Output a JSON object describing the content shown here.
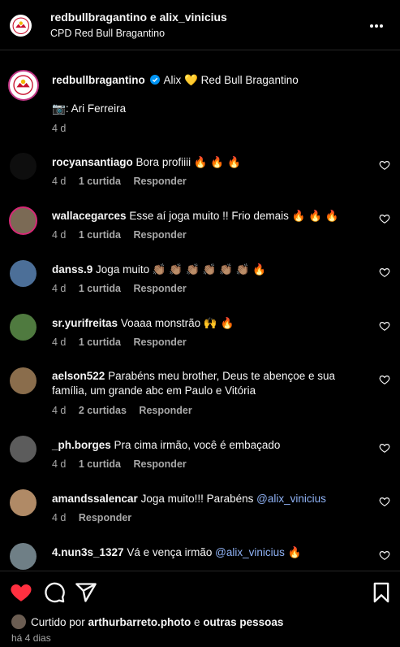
{
  "header": {
    "title": "redbullbragantino e alix_vinicius",
    "subtitle": "CPD Red Bull Bragantino"
  },
  "caption": {
    "username": "redbullbragantino",
    "text_part1": "Alix",
    "emoji_heart": "💛",
    "text_part2": "Red Bull Bragantino",
    "credit_emoji": "📷",
    "credit": ": Ari Ferreira",
    "time": "4 d"
  },
  "comments": [
    {
      "username": "rocyansantiago",
      "text": "Bora profiiii 🔥 🔥 🔥",
      "time": "4 d",
      "likes": "1 curtida",
      "reply": "Responder",
      "avatar_color": "#0e0e0e"
    },
    {
      "username": "wallacegarces",
      "text": "Esse aí joga muito !! Frio demais 🔥 🔥 🔥",
      "time": "4 d",
      "likes": "1 curtida",
      "reply": "Responder",
      "avatar_color": "#7b6a55"
    },
    {
      "username": "danss.9",
      "text": "Joga muito 👏🏽 👏🏽 👏🏽 👏🏽 👏🏽 👏🏽 🔥",
      "time": "4 d",
      "likes": "1 curtida",
      "reply": "Responder",
      "avatar_color": "#4c6f98"
    },
    {
      "username": "sr.yurifreitas",
      "text": "Voaaa monstrão 🙌 🔥",
      "time": "4 d",
      "likes": "1 curtida",
      "reply": "Responder",
      "avatar_color": "#4f7a3f"
    },
    {
      "username": "aelson522",
      "text_line1": "Parabéns meu brother, Deus te abençoe e sua",
      "text_line2": "família, um grande abc em Paulo e Vitória",
      "time": "4 d",
      "likes": "2 curtidas",
      "reply": "Responder",
      "avatar_color": "#8a6d4c"
    },
    {
      "username": "_ph.borges",
      "text": "Pra cima irmão, você é embaçado",
      "time": "4 d",
      "likes": "1 curtida",
      "reply": "Responder",
      "avatar_color": "#5c5c5c"
    },
    {
      "username": "amandssalencar",
      "text": "Joga muito!!! Parabéns ",
      "mention": "@alix_vinicius",
      "time": "4 d",
      "reply": "Responder",
      "avatar_color": "#b08a66"
    },
    {
      "username": "4.nun3s_1327",
      "text": "Vá e vença irmão ",
      "mention": "@alix_vinicius",
      "suffix": " 🔥",
      "avatar_color": "#6f7f86"
    }
  ],
  "footer": {
    "liked_by_prefix": "Curtido por ",
    "liked_by_user": "arthurbarreto.photo",
    "liked_by_suffix": " e ",
    "others": "outras pessoas",
    "date": "há 4 dias"
  },
  "colors": {
    "like_red": "#ff3040",
    "mention_blue": "#8fb2f5",
    "muted": "#a8a8a8"
  }
}
